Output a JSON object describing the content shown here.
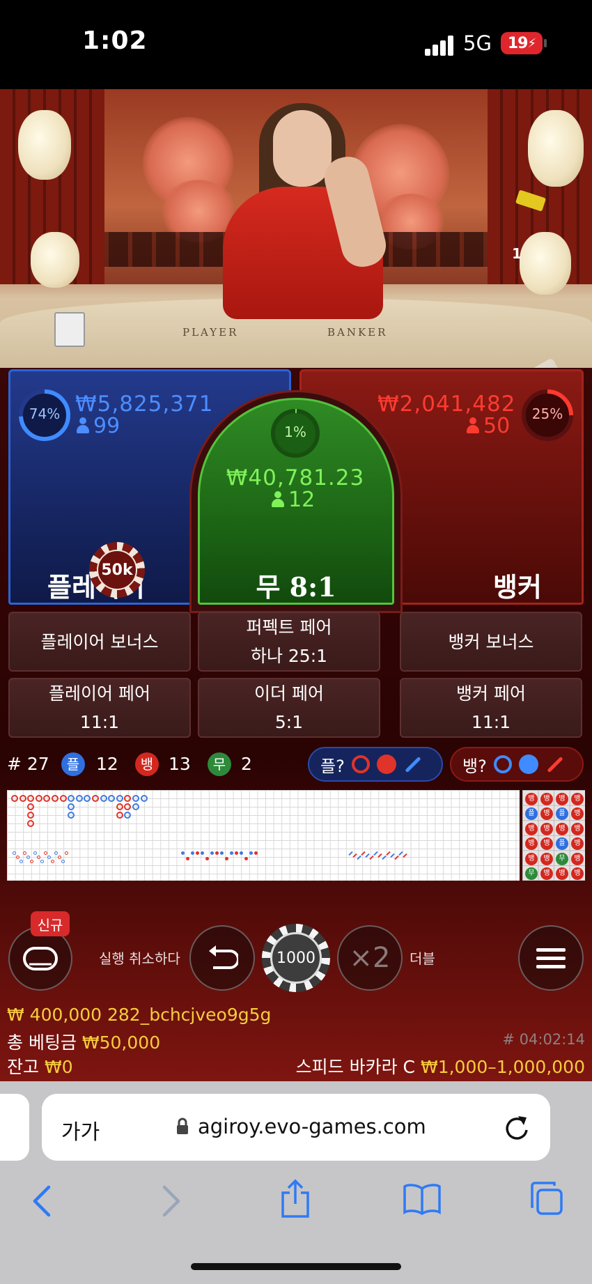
{
  "status_bar": {
    "time": "1:02",
    "network": "5G",
    "battery": "19"
  },
  "video": {
    "table_left_text": "PLAYER",
    "table_right_text": "BANKER",
    "camera_number": "1"
  },
  "player": {
    "percent": "74%",
    "percent_value": 74,
    "amount": "₩5,825,371",
    "count": "99",
    "label": "플레이어"
  },
  "tie": {
    "percent": "1%",
    "percent_value": 1,
    "amount": "₩40,781.23",
    "count": "12",
    "label": "무 8:1"
  },
  "banker": {
    "percent": "25%",
    "percent_value": 25,
    "amount": "₩2,041,482",
    "count": "50",
    "label": "뱅커"
  },
  "placed_chip": "50k",
  "side_bets": [
    {
      "line1": "플레이어 보너스",
      "line2": ""
    },
    {
      "line1": "퍼펙트 페어",
      "line2": "하나 25:1"
    },
    {
      "line1": "뱅커 보너스",
      "line2": ""
    },
    {
      "line1": "플레이어 페어",
      "line2": "11:1"
    },
    {
      "line1": "이더 페어",
      "line2": "5:1"
    },
    {
      "line1": "뱅커 페어",
      "line2": "11:1"
    }
  ],
  "stats": {
    "round": "# 27",
    "player_badge": "플",
    "player_count": "12",
    "banker_badge": "뱅",
    "banker_count": "13",
    "tie_badge": "무",
    "tie_count": "2"
  },
  "predict": {
    "player_label": "플?",
    "banker_label": "뱅?"
  },
  "bead_plate": [
    [
      "뱅",
      "뱅",
      "뱅",
      "뱅"
    ],
    [
      "플",
      "뱅",
      "플",
      "뱅"
    ],
    [
      "뱅",
      "뱅",
      "뱅",
      "뱅"
    ],
    [
      "뱅",
      "뱅",
      "플",
      "뱅"
    ],
    [
      "뱅",
      "뱅",
      "무",
      "뱅"
    ],
    [
      "무",
      "뱅",
      "뱅",
      "뱅"
    ]
  ],
  "controls": {
    "new_badge": "신규",
    "undo_label": "실행 취소하다",
    "chip_value": "1000",
    "double_symbol": "×2",
    "double_label": "더블"
  },
  "info": {
    "balance_line": "₩ 400,000 282_bchcjveo9g5g",
    "total_bet_label": "총 베팅금",
    "total_bet_value": "₩50,000",
    "round_id": "# 04:02:14",
    "remaining_label": "잔고",
    "remaining_value": "₩0",
    "table_name": "스피드 바카라 C",
    "limits": "₩1,000–1,000,000"
  },
  "browser": {
    "text_size": "가가",
    "url": "agiroy.evo-games.com"
  },
  "colors": {
    "player": "#2a64d6",
    "banker": "#d02a22",
    "tie": "#52c43c",
    "gold": "#f6cd3c",
    "safari_blue": "#2f7af5"
  }
}
